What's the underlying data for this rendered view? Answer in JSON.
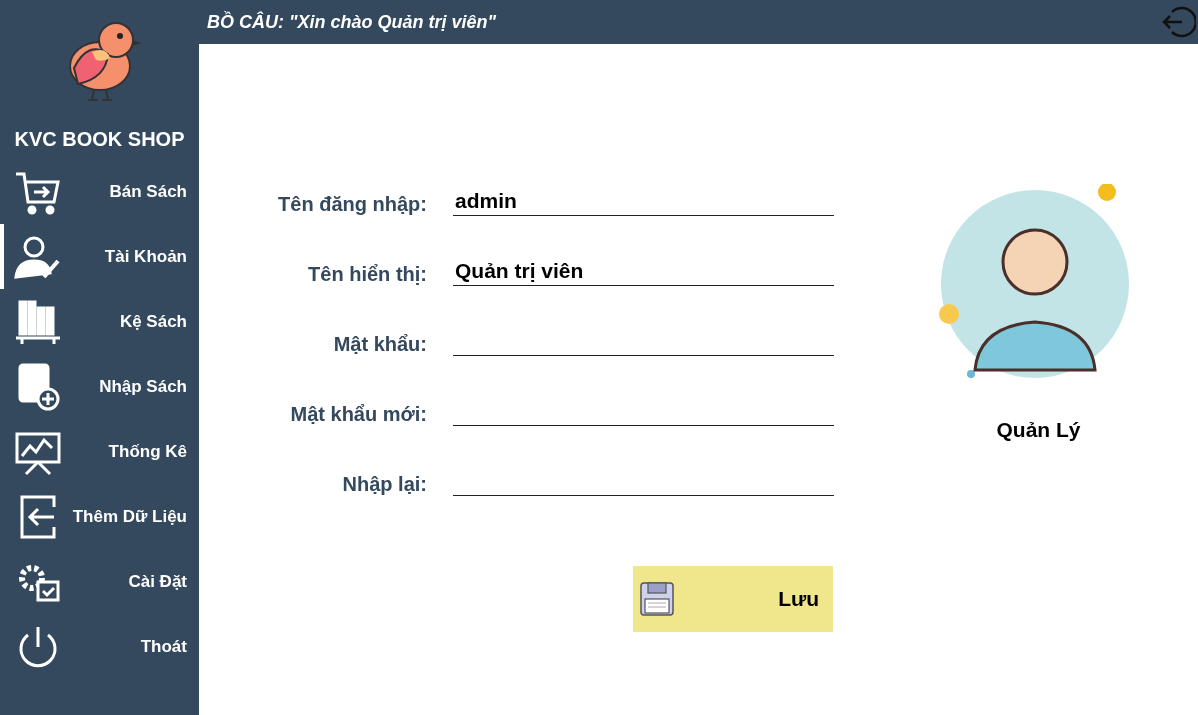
{
  "header": {
    "title": "BỒ CÂU: \"Xin chào Quản trị viên\""
  },
  "sidebar": {
    "brand": "KVC BOOK SHOP",
    "items": [
      {
        "label": "Bán Sách",
        "selected": false
      },
      {
        "label": "Tài Khoản",
        "selected": true
      },
      {
        "label": "Kệ Sách",
        "selected": false
      },
      {
        "label": "Nhập Sách",
        "selected": false
      },
      {
        "label": "Thống Kê",
        "selected": false
      },
      {
        "label": "Thêm Dữ Liệu",
        "selected": false
      },
      {
        "label": "Cài Đặt",
        "selected": false
      },
      {
        "label": "Thoát",
        "selected": false
      }
    ]
  },
  "form": {
    "fields": [
      {
        "label": "Tên đăng nhập:",
        "value": "admin",
        "kind": "text"
      },
      {
        "label": "Tên hiển thị:",
        "value": "Quản trị viên",
        "kind": "text"
      },
      {
        "label": "Mật khẩu:",
        "kind": "password"
      },
      {
        "label": "Mật khẩu mới:",
        "kind": "password"
      },
      {
        "label": "Nhập lại:",
        "kind": "password"
      }
    ],
    "save_button": "Lưu"
  },
  "profile": {
    "role": "Quản Lý"
  }
}
